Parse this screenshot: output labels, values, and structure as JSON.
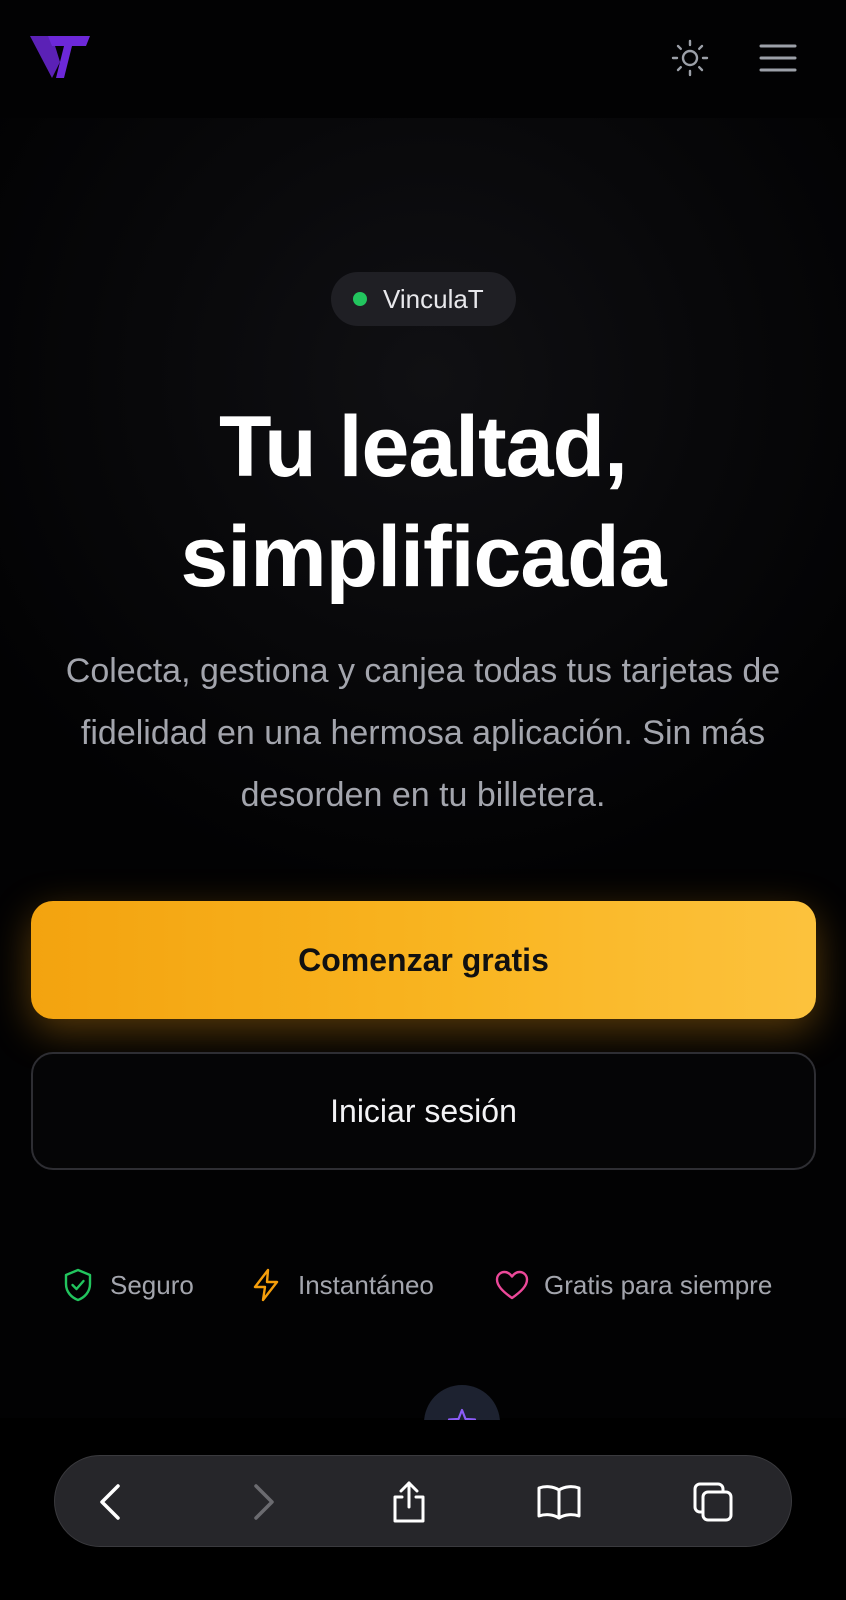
{
  "header": {
    "logo_alt": "VT",
    "theme_toggle": "sun-icon",
    "menu": "hamburger-icon"
  },
  "hero": {
    "badge": {
      "label": "VinculaT",
      "dot_color": "#22c55e"
    },
    "headline_line1": "Tu lealtad,",
    "headline_line2": "simplificada",
    "subtitle": "Colecta, gestiona y canjea todas tus tarjetas de fidelidad en una hermosa aplicación. Sin más desorden en tu billetera.",
    "primary_cta": "Comenzar gratis",
    "secondary_cta": "Iniciar sesión",
    "features": [
      {
        "label": "Seguro",
        "icon": "shield-check-icon",
        "color": "#22c55e"
      },
      {
        "label": "Instantáneo",
        "icon": "bolt-icon",
        "color": "#f59e0b"
      },
      {
        "label": "Gratis para siempre",
        "icon": "heart-icon",
        "color": "#ec4899"
      }
    ]
  },
  "browser_toolbar": {
    "items": [
      "back-icon",
      "forward-icon",
      "share-icon",
      "bookmarks-icon",
      "tabs-icon"
    ]
  },
  "colors": {
    "accent": "#f9b521",
    "brand": "#6d28d9",
    "background": "#000000"
  }
}
